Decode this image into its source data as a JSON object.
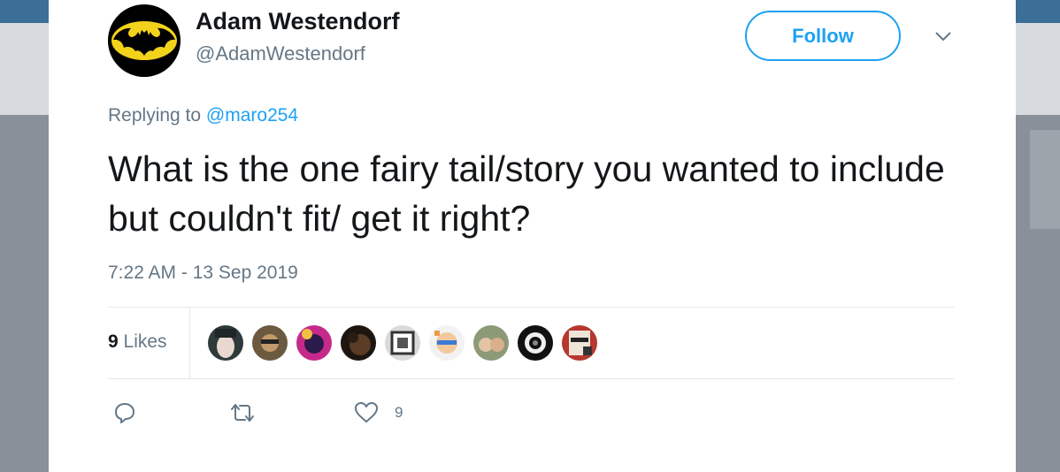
{
  "tweet": {
    "author_name": "Adam Westendorf",
    "author_handle": "@AdamWestendorf",
    "follow_label": "Follow",
    "replying_prefix": "Replying to",
    "replying_to": "@maro254",
    "text": "What is the one fairy tail/story you wanted to include but couldn't fit/ get it right?",
    "timestamp": "7:22 AM - 13 Sep 2019",
    "likes_number": "9",
    "likes_word": "Likes",
    "actions": {
      "like_count": "9"
    }
  },
  "colors": {
    "accent": "#1da1f2",
    "muted_text": "#657786",
    "primary_text": "#14171a",
    "avatar_logo_yellow": "#f2d21b"
  },
  "icons": {
    "avatar": "batman-logo-avatar",
    "menu": "chevron-down-icon",
    "reply": "reply-icon",
    "retweet": "retweet-icon",
    "like": "heart-icon"
  }
}
